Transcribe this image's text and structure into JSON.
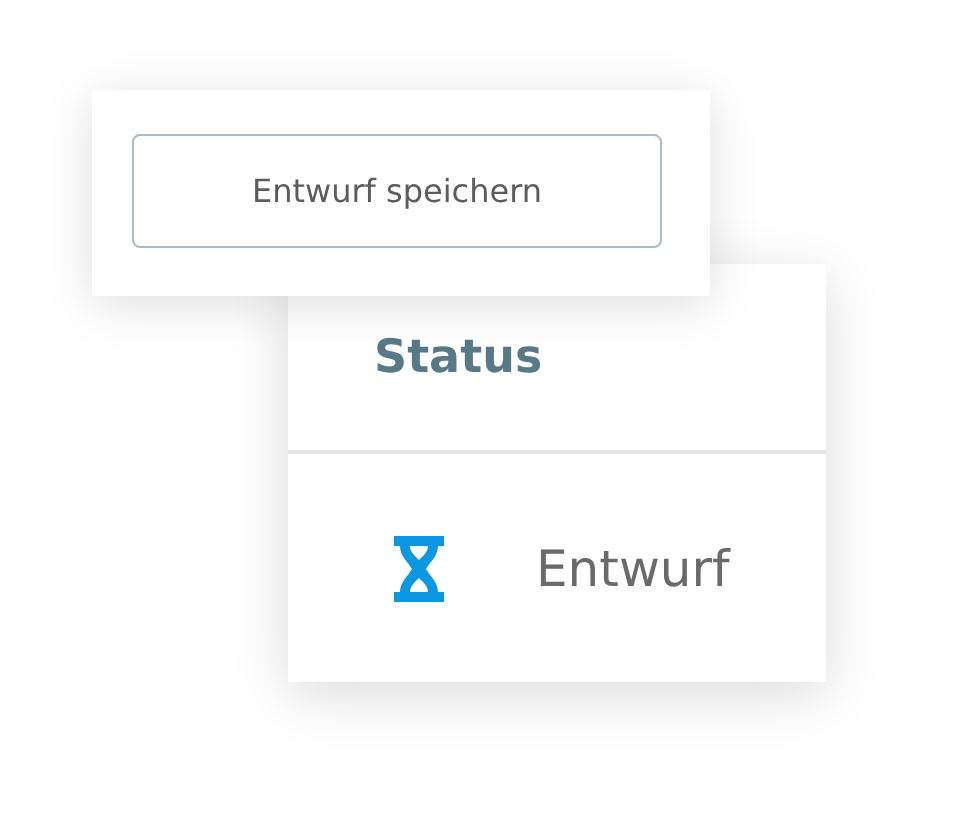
{
  "save_button": {
    "label": "Entwurf speichern"
  },
  "status_card": {
    "header": "Status",
    "status": {
      "kind": "draft",
      "label": "Entwurf"
    }
  }
}
